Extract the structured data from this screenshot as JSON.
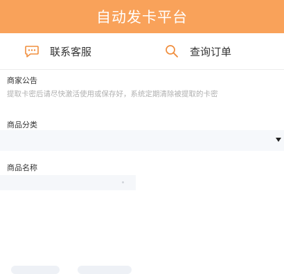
{
  "header": {
    "title": "自动发卡平台"
  },
  "nav": {
    "contact_label": "联系客服",
    "query_label": "查询订单",
    "contact_icon": "chat-bubble-icon",
    "query_icon": "search-icon"
  },
  "notice": {
    "label": "商家公告",
    "text": "提取卡密后请尽快激活使用或保存好，系统定期清除被提取的卡密"
  },
  "category": {
    "label": "商品分类",
    "value": ""
  },
  "product": {
    "label": "商品名称",
    "value": ""
  },
  "colors": {
    "accent": "#f9a25a",
    "icon": "#f08d3c"
  }
}
